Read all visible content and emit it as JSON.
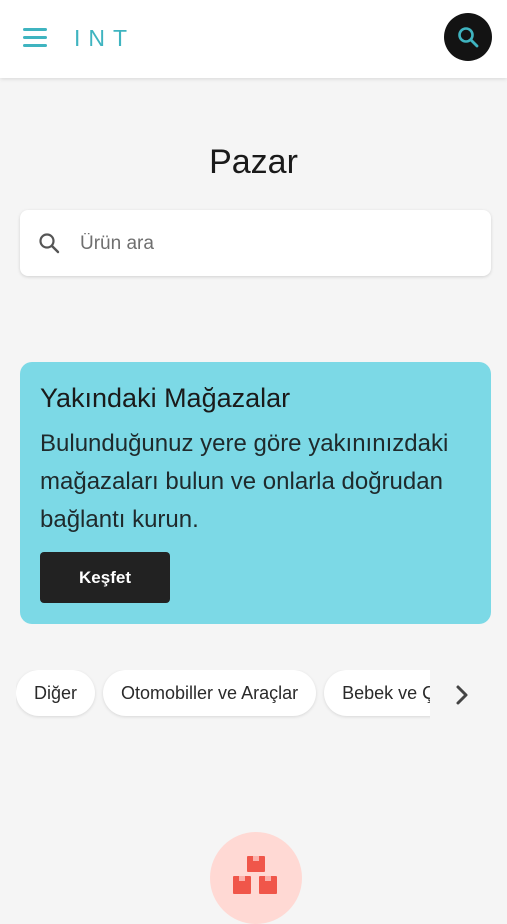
{
  "header": {
    "brand": "INT",
    "menu_icon": "hamburger-menu-icon",
    "search_icon": "search-icon",
    "accent_color": "#3fb4c0"
  },
  "page": {
    "title": "Pazar"
  },
  "search": {
    "placeholder": "Ürün ara",
    "value": ""
  },
  "promo": {
    "title": "Yakındaki Mağazalar",
    "description": "Bulunduğunuz yere göre yakınınızdaki mağazaları bulun ve onlarla doğrudan bağlantı kurun.",
    "button_label": "Keşfet",
    "background_color": "#7cd9e6"
  },
  "categories": {
    "items": [
      {
        "label": "Diğer"
      },
      {
        "label": "Otomobiller ve Araçlar"
      },
      {
        "label": "Bebek ve Çocuk"
      }
    ],
    "next_icon": "chevron-right-icon"
  },
  "empty_state": {
    "icon": "boxes-icon",
    "icon_color": "#f0564a"
  }
}
